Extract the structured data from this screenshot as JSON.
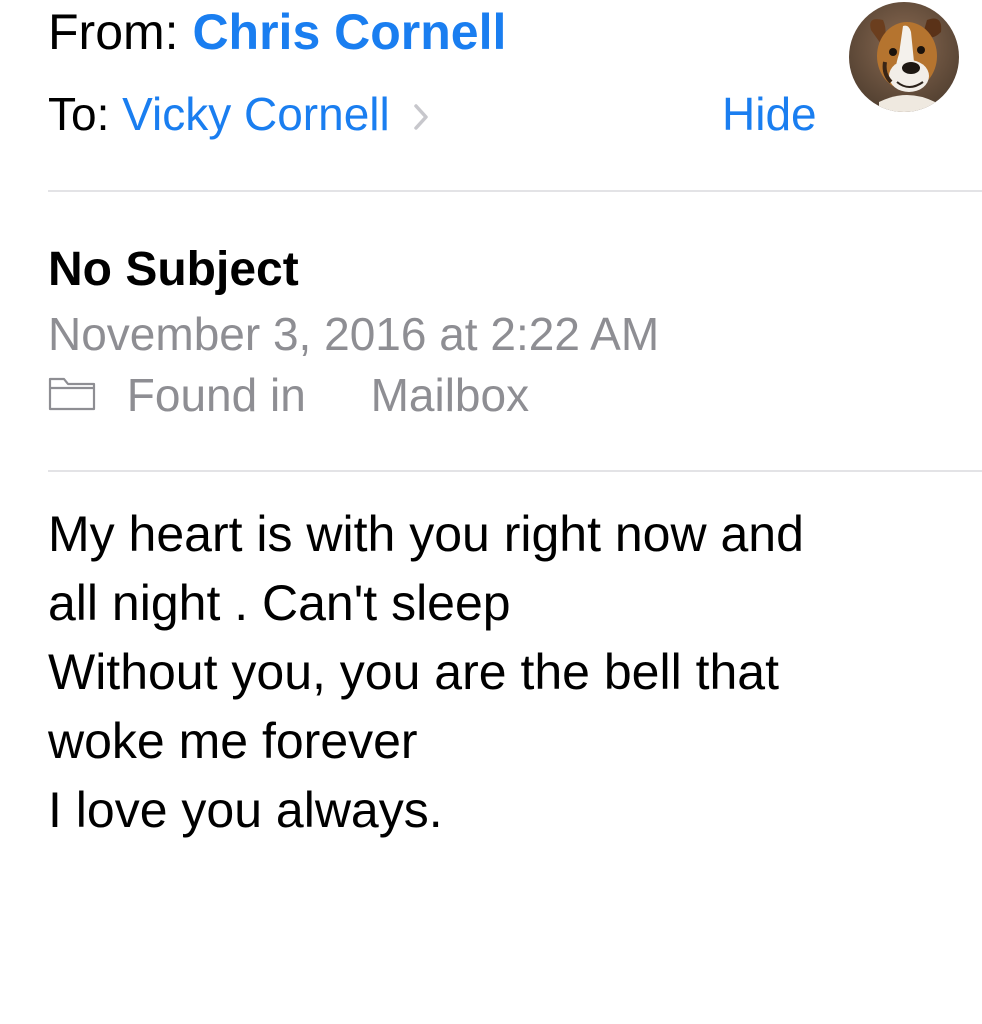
{
  "header": {
    "from_label": "From:",
    "from_name": "Chris Cornell",
    "to_label": "To:",
    "to_name": "Vicky Cornell",
    "hide_label": "Hide",
    "avatar_icon": "dog-avatar",
    "chevron_icon": "chevron-right-icon"
  },
  "message": {
    "subject": "No Subject",
    "date": "November 3, 2016 at 2:22 AM",
    "found_in_label": "Found in",
    "mailbox": "Mailbox",
    "folder_icon": "folder-icon",
    "body_lines": [
      "My heart is with you right now and",
      "all night . Can't sleep",
      "Without you, you are the bell that",
      "woke me forever",
      "I love you always."
    ]
  },
  "colors": {
    "link": "#1a7ef0",
    "secondary": "#8e8e93",
    "divider": "#e3e3e6",
    "text": "#000000"
  }
}
